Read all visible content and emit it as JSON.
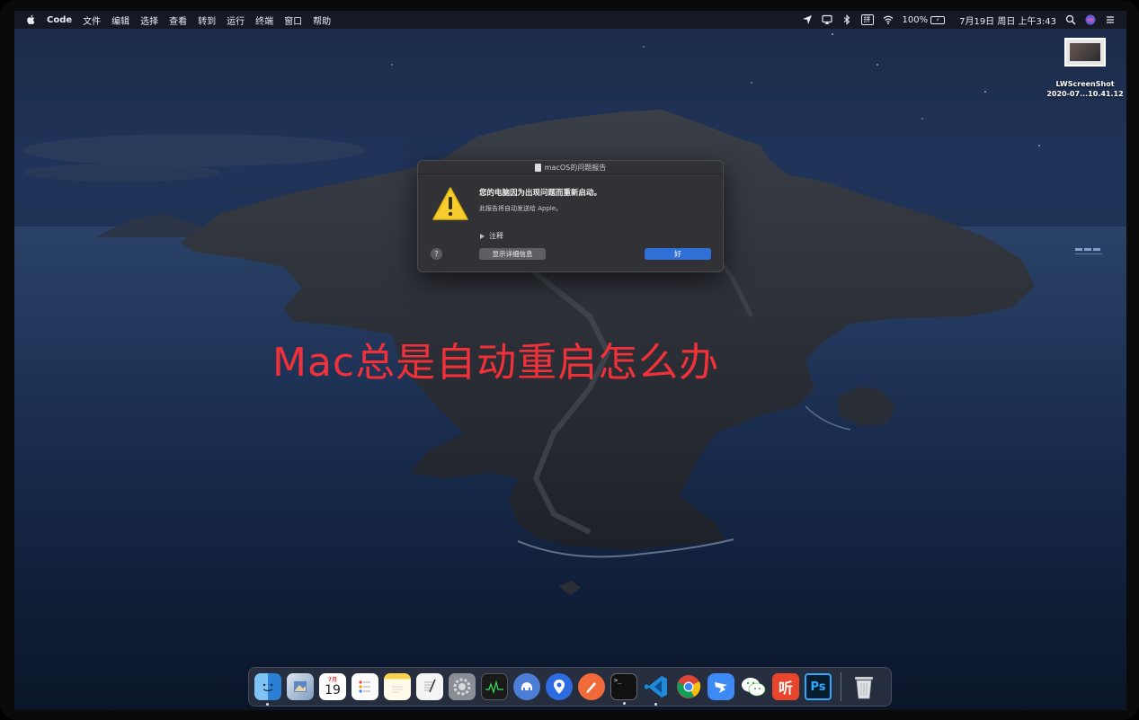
{
  "menubar": {
    "app_name": "Code",
    "items": [
      "文件",
      "编辑",
      "选择",
      "查看",
      "转到",
      "运行",
      "终端",
      "窗口",
      "帮助"
    ],
    "battery": "100%",
    "ime": "拼",
    "datetime": "7月19日 周日 上午3:43"
  },
  "desktop_file": {
    "name_line1": "LWScreenShot",
    "name_line2": "2020-07...10.41.12"
  },
  "dialog": {
    "title": "macOS的问题报告",
    "message": "您的电脑因为出现问题而重新启动。",
    "submessage": "此报告将自动发送给 Apple。",
    "notes_label": "注释",
    "help_label": "?",
    "details_button": "显示详细信息",
    "ok_button": "好"
  },
  "overlay": {
    "headline": "Mac总是自动重启怎么办"
  },
  "dock": {
    "calendar_month": "7月",
    "calendar_day": "19",
    "photoshop_label": "Ps",
    "ting_label": "听",
    "terminal_label": ">_"
  },
  "colors": {
    "headline": "#f0313a",
    "ok_button": "#2f6fd8",
    "dialog_bg": "#323236"
  }
}
